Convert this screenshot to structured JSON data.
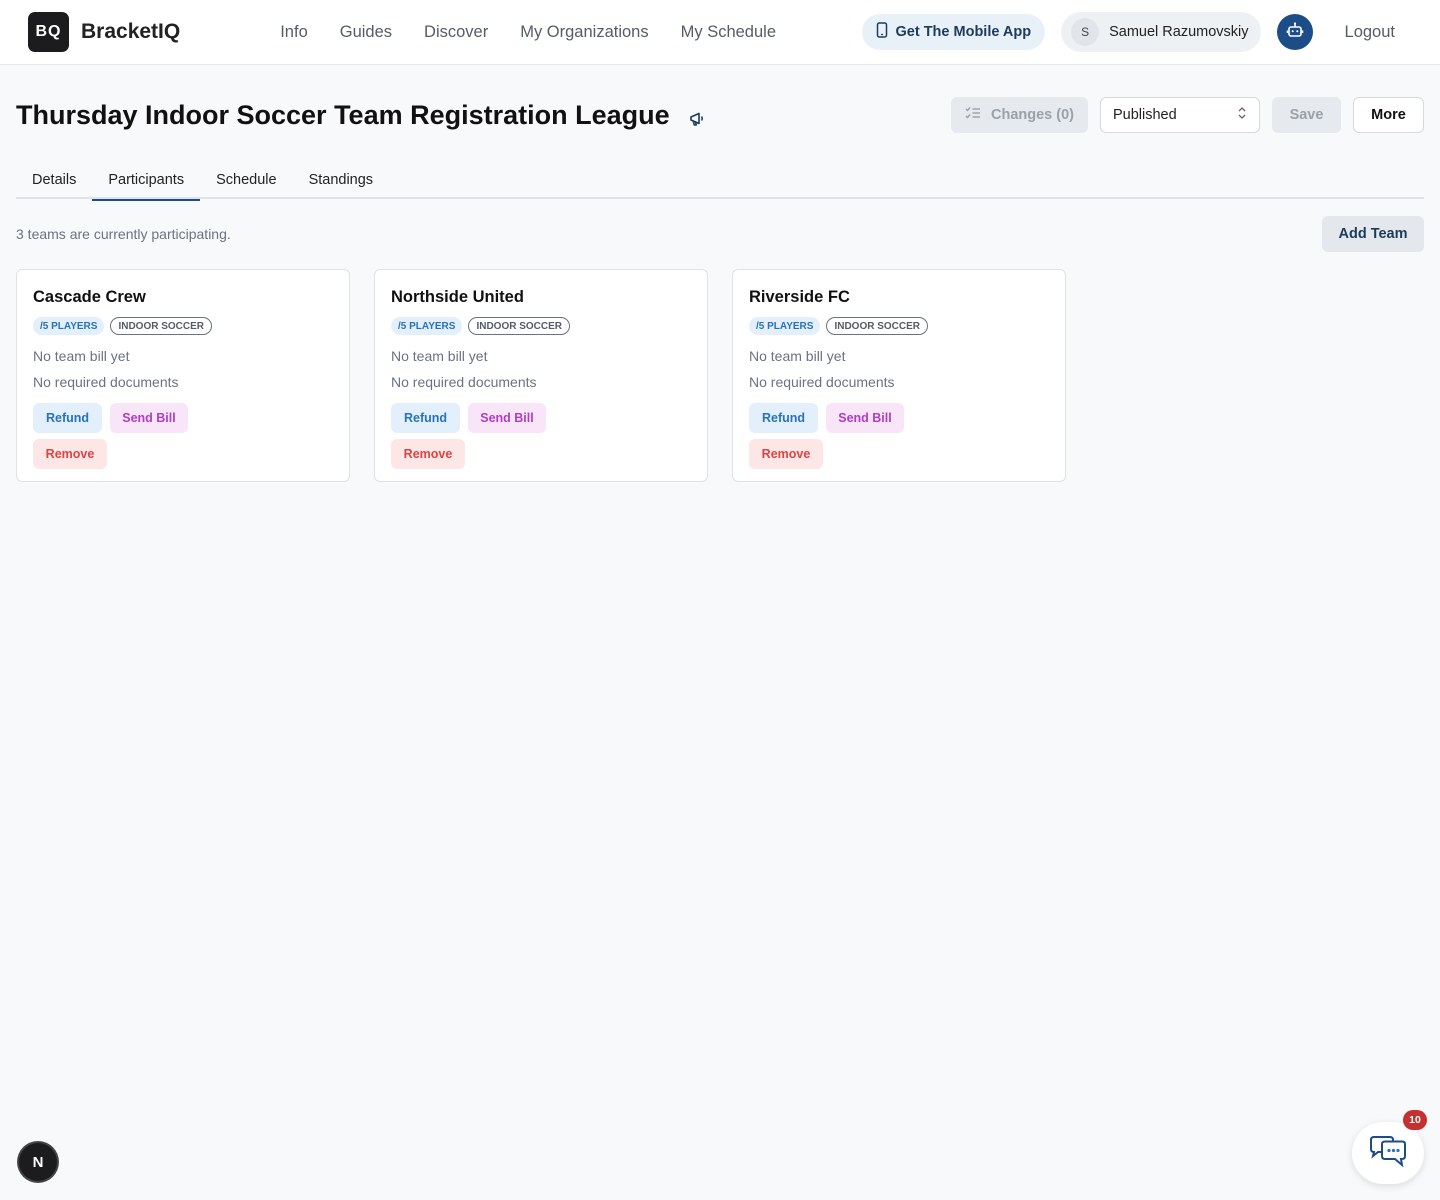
{
  "brand": {
    "logo_text": "BQ",
    "name": "BracketIQ"
  },
  "nav": {
    "items": [
      "Info",
      "Guides",
      "Discover",
      "My Organizations",
      "My Schedule"
    ]
  },
  "header": {
    "mobile_app_label": "Get The Mobile App",
    "user_initial": "S",
    "user_name": "Samuel Razumovskiy",
    "logout_label": "Logout"
  },
  "page": {
    "title": "Thursday Indoor Soccer Team Registration League",
    "changes_label": "Changes (0)",
    "status_value": "Published",
    "save_label": "Save",
    "more_label": "More"
  },
  "tabs": [
    {
      "label": "Details",
      "active": false
    },
    {
      "label": "Participants",
      "active": true
    },
    {
      "label": "Schedule",
      "active": false
    },
    {
      "label": "Standings",
      "active": false
    }
  ],
  "participants": {
    "summary": "3 teams are currently participating.",
    "add_team_label": "Add Team",
    "teams": [
      {
        "name": "Cascade Crew",
        "players_badge": "/5 PLAYERS",
        "sport_badge": "INDOOR SOCCER",
        "bill_status": "No team bill yet",
        "documents_status": "No required documents",
        "refund_label": "Refund",
        "send_bill_label": "Send Bill",
        "remove_label": "Remove"
      },
      {
        "name": "Northside United",
        "players_badge": "/5 PLAYERS",
        "sport_badge": "INDOOR SOCCER",
        "bill_status": "No team bill yet",
        "documents_status": "No required documents",
        "refund_label": "Refund",
        "send_bill_label": "Send Bill",
        "remove_label": "Remove"
      },
      {
        "name": "Riverside FC",
        "players_badge": "/5 PLAYERS",
        "sport_badge": "INDOOR SOCCER",
        "bill_status": "No team bill yet",
        "documents_status": "No required documents",
        "refund_label": "Refund",
        "send_bill_label": "Send Bill",
        "remove_label": "Remove"
      }
    ]
  },
  "floating": {
    "dev_badge": "N",
    "chat_unread_count": "10"
  },
  "colors": {
    "accent": "#1d4d86",
    "refund": "#2873b8",
    "send_bill": "#b23cc2",
    "remove": "#dc4545",
    "notification": "#c53030"
  },
  "icons": {
    "mobile": "phone-icon",
    "assistant": "robot-icon",
    "announce": "megaphone-icon",
    "changes": "checklist-icon",
    "select": "chevron-up-down-icon",
    "chat": "chat-bubbles-icon"
  }
}
